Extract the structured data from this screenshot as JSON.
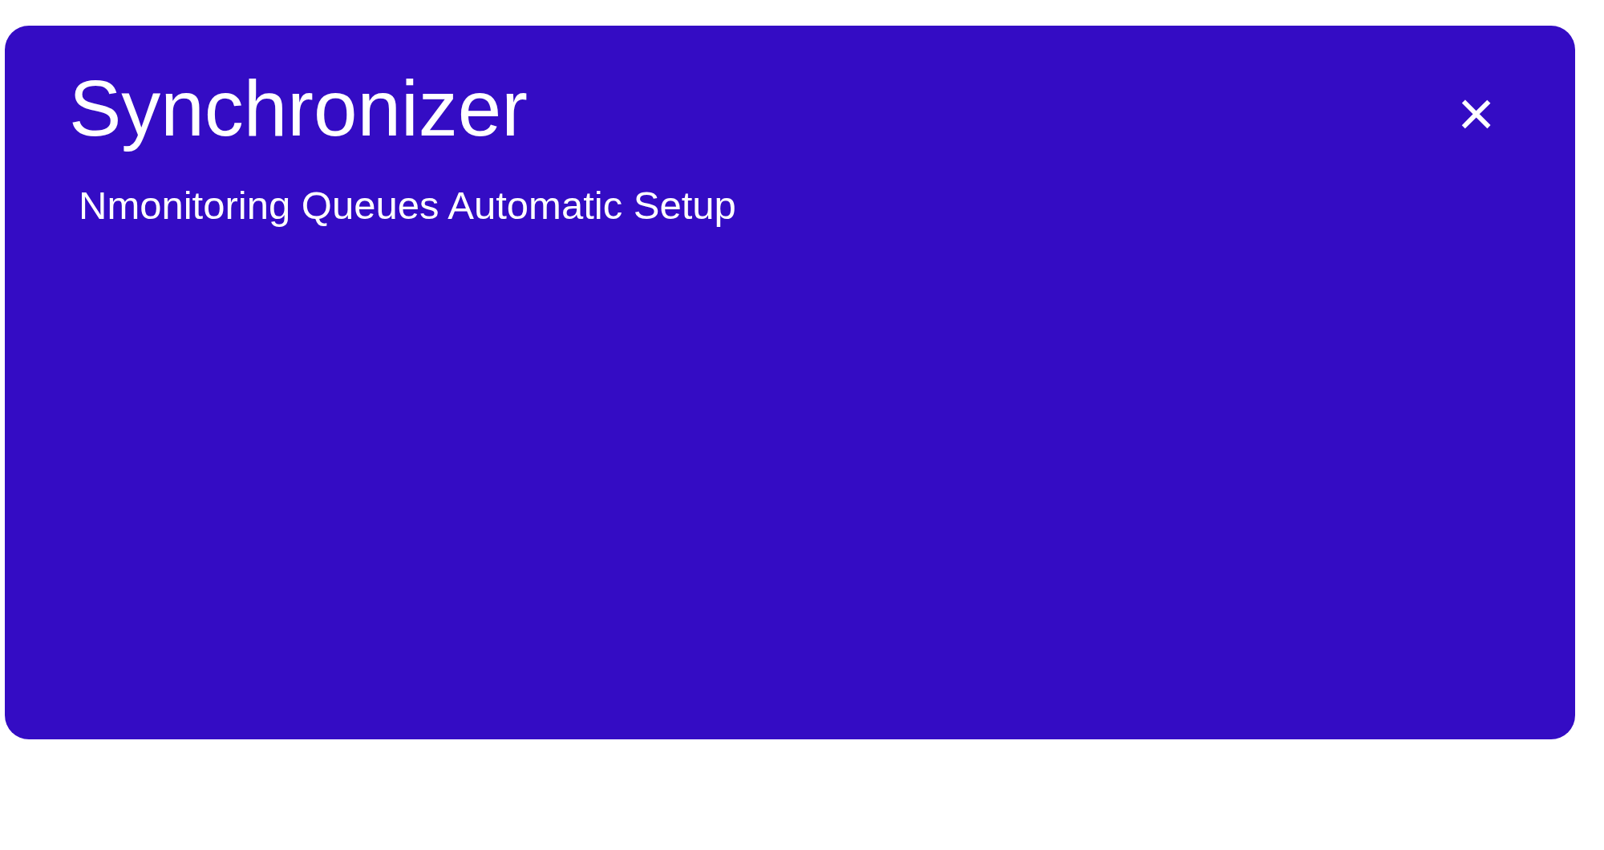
{
  "card": {
    "title": "Synchronizer",
    "subtitle": "Nmonitoring Queues Automatic Setup",
    "close_label": "×"
  }
}
